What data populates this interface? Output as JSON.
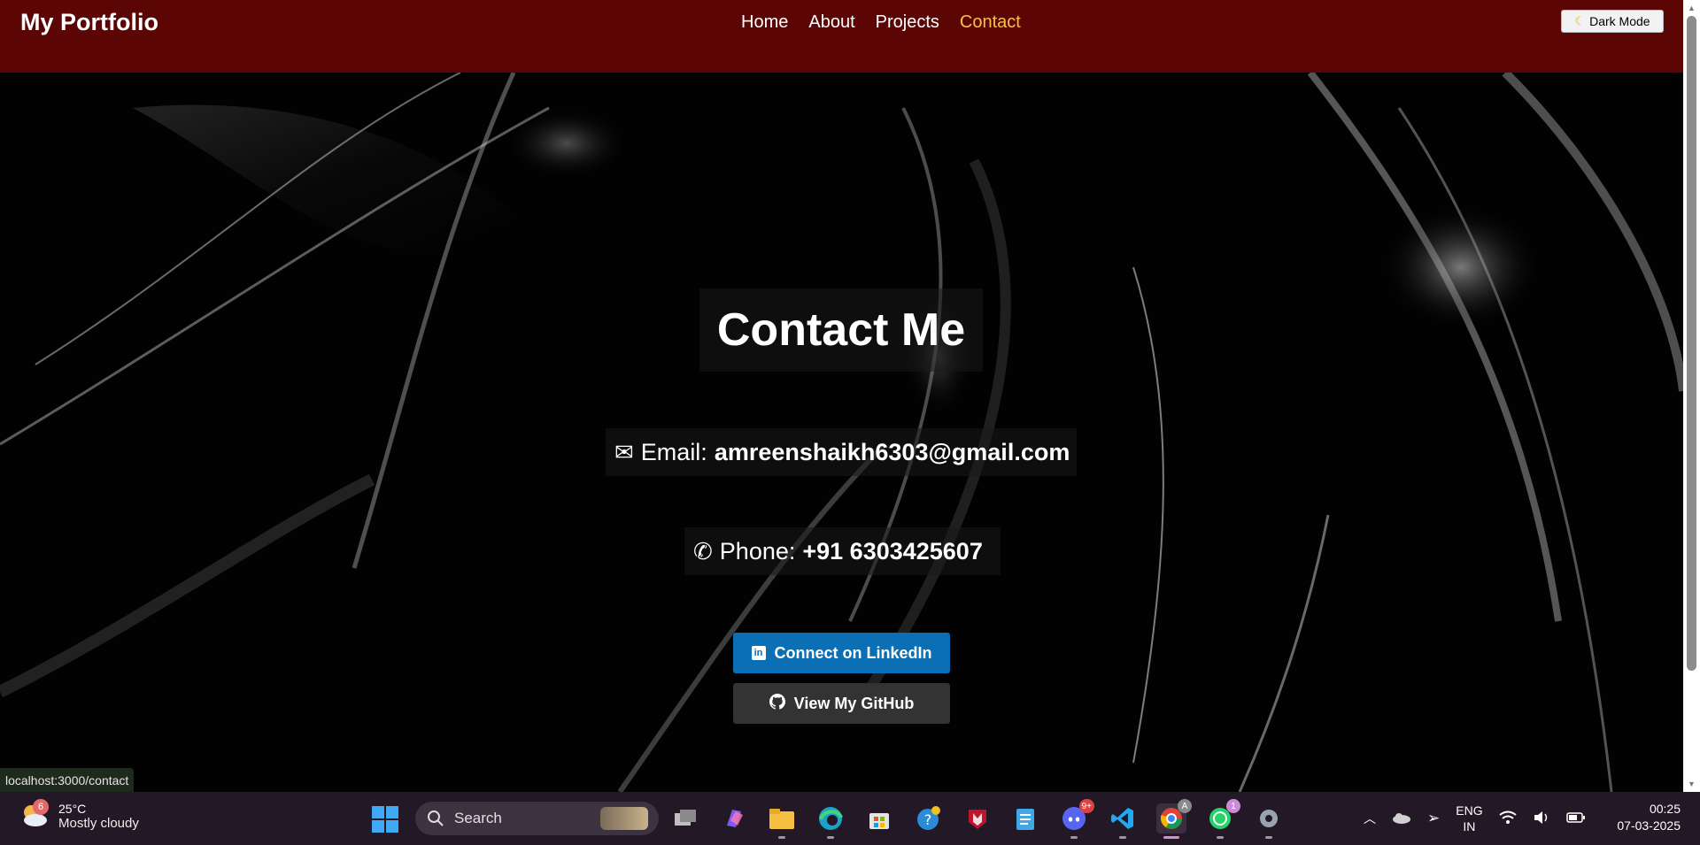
{
  "navbar": {
    "brand": "My Portfolio",
    "links": [
      "Home",
      "About",
      "Projects",
      "Contact"
    ],
    "active_link": "Contact",
    "dark_mode_label": "Dark Mode"
  },
  "contact": {
    "title": "Contact Me",
    "email_label": "Email:",
    "email_value": "amreenshaikh6303@gmail.com",
    "phone_label": "Phone:",
    "phone_value": "+91 6303425607",
    "linkedin_label": "Connect on LinkedIn",
    "github_label": "View My GitHub"
  },
  "status_url": "localhost:3000/contact",
  "taskbar": {
    "weather_badge": "6",
    "temperature": "25°C",
    "condition": "Mostly cloudy",
    "search_placeholder": "Search",
    "discord_badge": "9+",
    "whatsapp_badge": "1",
    "language_line1": "ENG",
    "language_line2": "IN",
    "time": "00:25",
    "date": "07-03-2025"
  },
  "colors": {
    "navbar_bg": "#5c0505",
    "active_link": "#f5c242",
    "linkedin_btn": "#0a6fb5",
    "github_btn": "#333333"
  }
}
